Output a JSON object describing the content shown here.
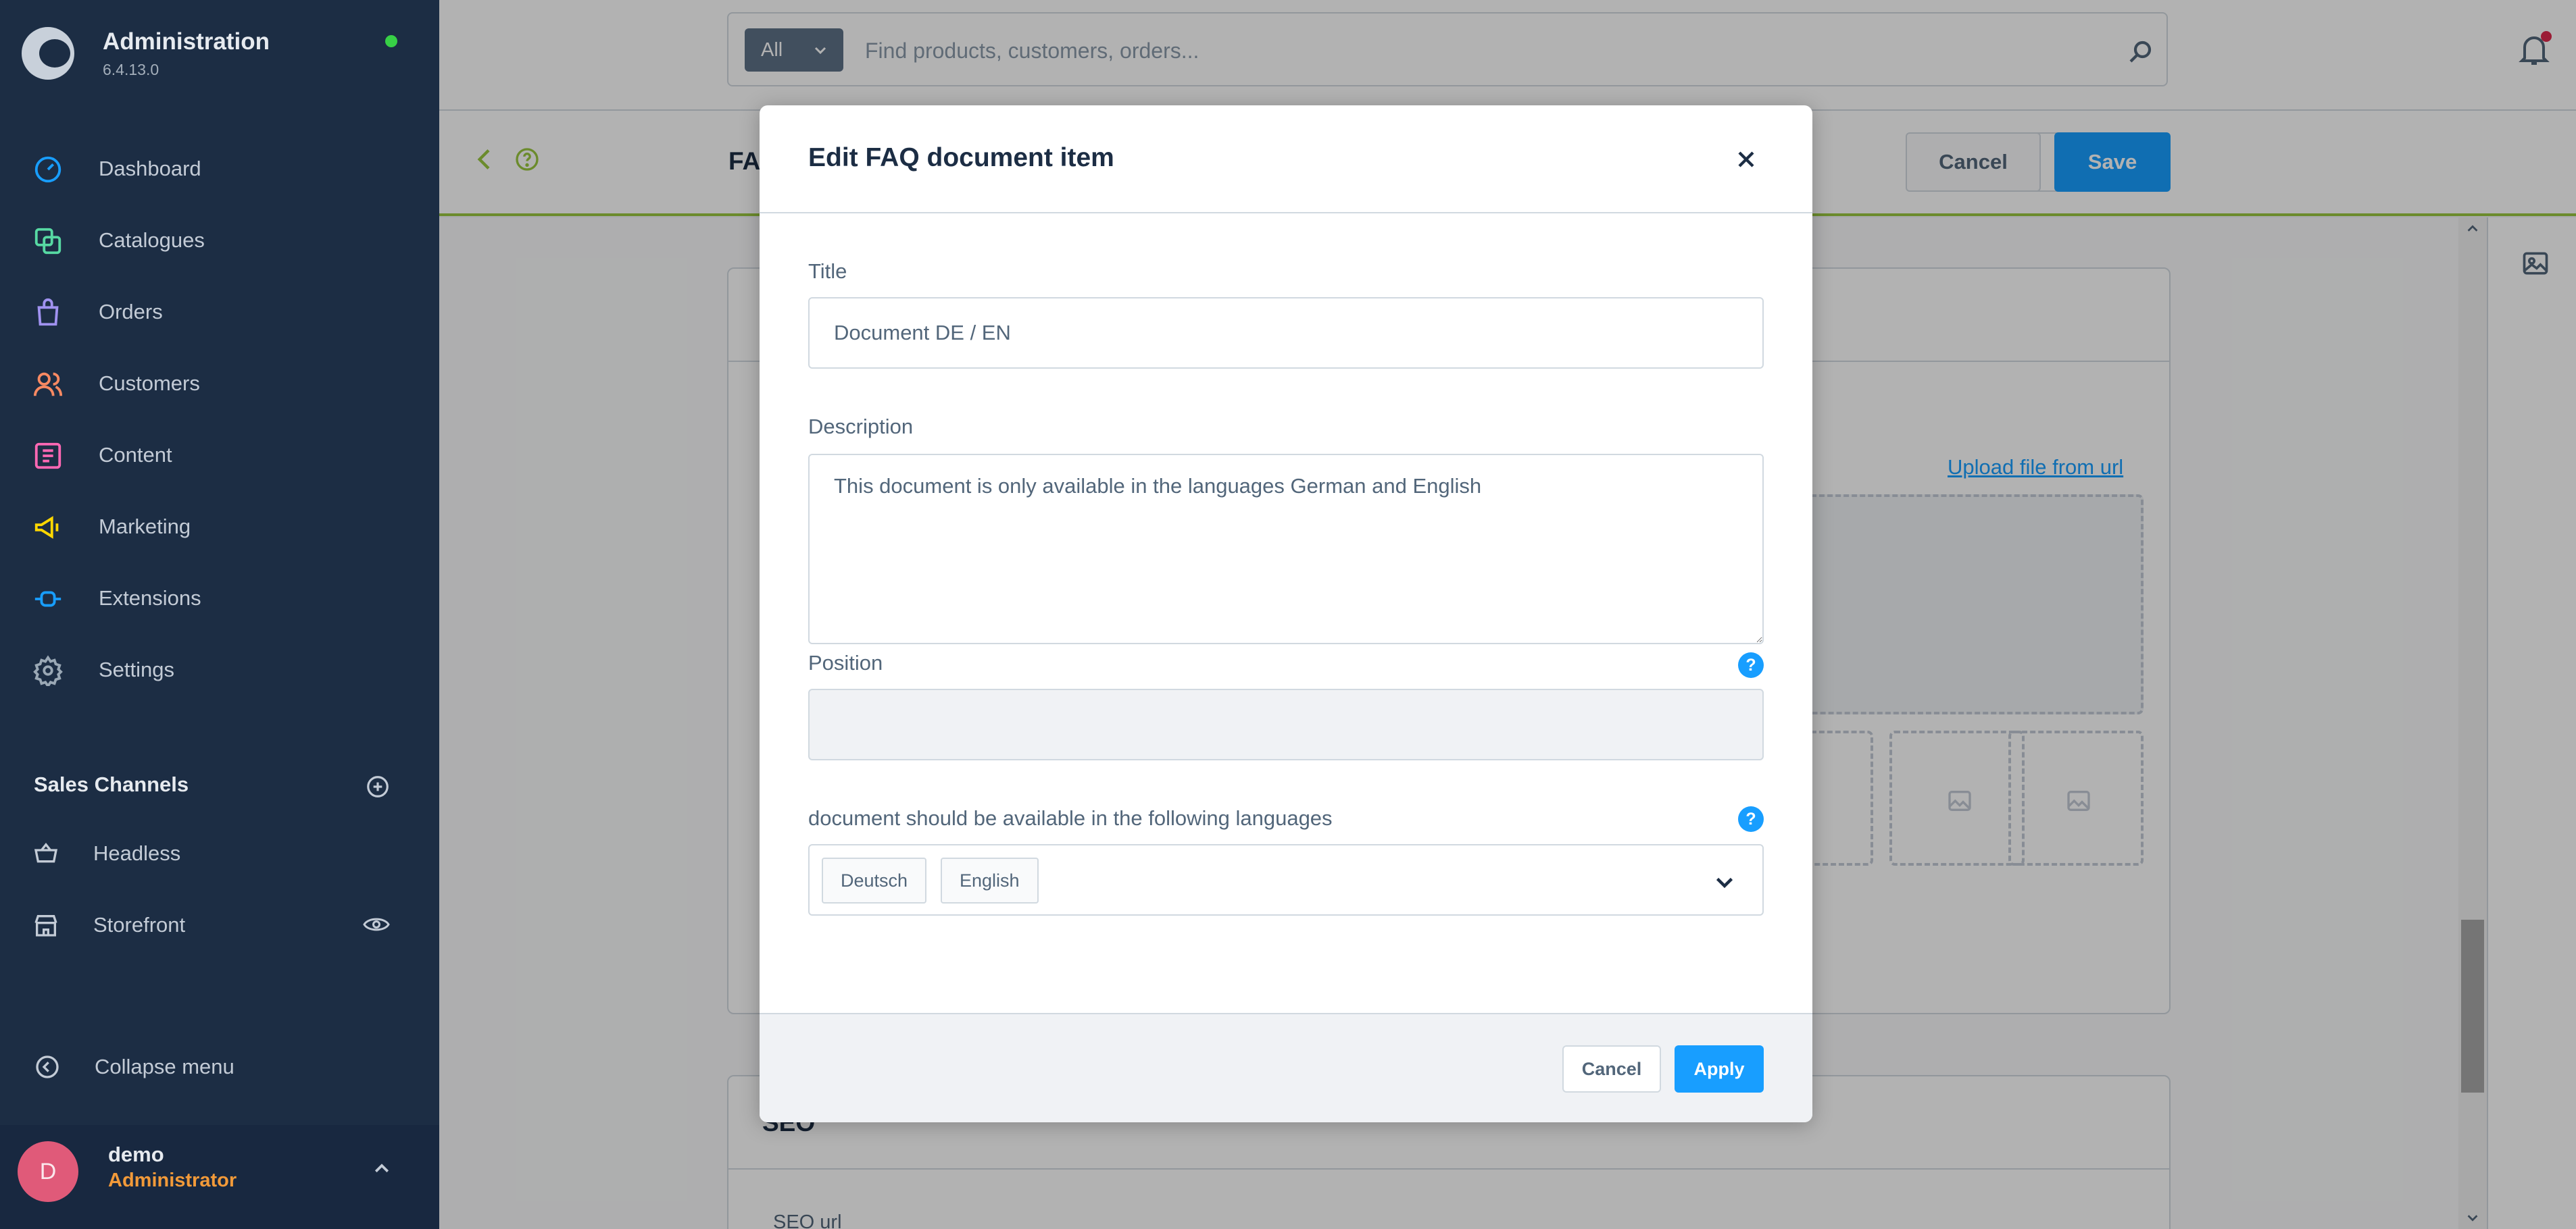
{
  "app": {
    "title": "Administration",
    "version": "6.4.13.0"
  },
  "sidebar": {
    "nav": [
      {
        "label": "Dashboard",
        "icon": "dashboard-icon",
        "color": "#189eff"
      },
      {
        "label": "Catalogues",
        "icon": "catalogue-icon",
        "color": "#57d9a3"
      },
      {
        "label": "Orders",
        "icon": "orders-icon",
        "color": "#a092f0"
      },
      {
        "label": "Customers",
        "icon": "customers-icon",
        "color": "#f88962"
      },
      {
        "label": "Content",
        "icon": "content-icon",
        "color": "#ff68b4"
      },
      {
        "label": "Marketing",
        "icon": "marketing-icon",
        "color": "#ffd700"
      },
      {
        "label": "Extensions",
        "icon": "extensions-icon",
        "color": "#189eff"
      },
      {
        "label": "Settings",
        "icon": "settings-icon",
        "color": "#9aa8b5"
      }
    ],
    "sales_channels": {
      "title": "Sales Channels",
      "items": [
        {
          "label": "Headless",
          "icon": "basket-icon"
        },
        {
          "label": "Storefront",
          "icon": "storefront-icon"
        }
      ]
    },
    "collapse_label": "Collapse menu",
    "user": {
      "initial": "D",
      "name": "demo",
      "role": "Administrator"
    }
  },
  "topbar": {
    "search_type": "All",
    "search_placeholder": "Find products, customers, orders..."
  },
  "smartbar": {
    "title_partial": "FA",
    "cancel_label": "Cancel",
    "save_label": "Save"
  },
  "content": {
    "upload_link": "Upload file from url",
    "seo_title": "SEO",
    "seo_url_label": "SEO url"
  },
  "modal": {
    "title": "Edit FAQ document item",
    "title_label": "Title",
    "title_value": "Document DE / EN",
    "description_label": "Description",
    "description_value": "This document is only available in the languages German and English",
    "position_label": "Position",
    "position_value": "",
    "languages_label": "document should be available in the following languages",
    "languages": [
      "Deutsch",
      "English"
    ],
    "help_symbol": "?",
    "cancel_label": "Cancel",
    "apply_label": "Apply"
  },
  "colors": {
    "accent": "#189eff",
    "sidebar_bg": "#1c2d44",
    "smartbar_border": "#9ac73f"
  }
}
